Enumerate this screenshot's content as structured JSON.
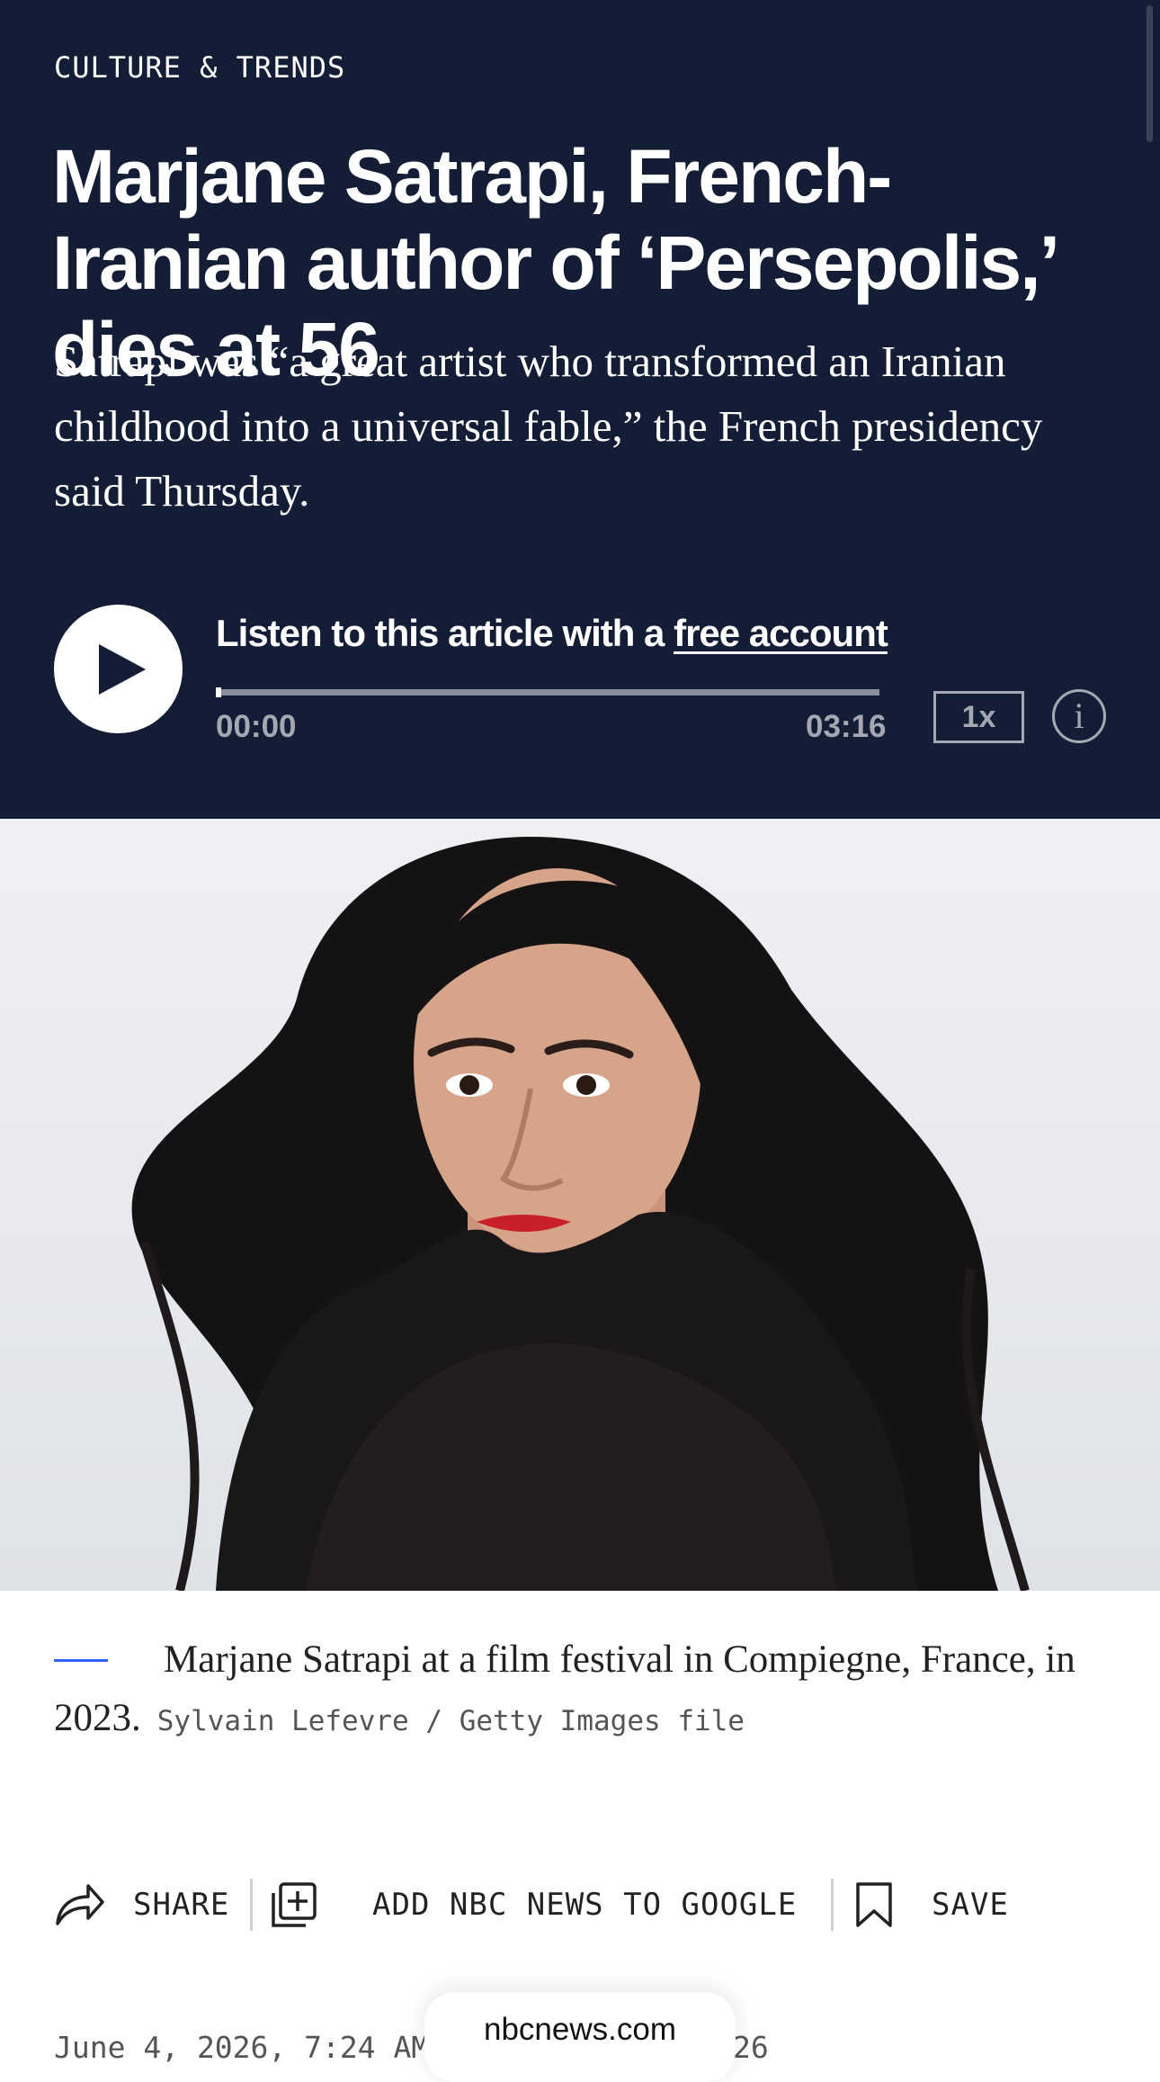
{
  "article": {
    "section": "CULTURE & TRENDS",
    "headline": "Marjane Satrapi, French-Iranian author of ‘Persepolis,’ dies at 56",
    "dek": "Satrapi was “a great artist who transformed an Iranian childhood into a universal fable,” the French presidency said Thursday."
  },
  "player": {
    "listen_prefix": "Listen to this article with a ",
    "listen_link": "free account",
    "time_current": "00:00",
    "time_total": "03:16",
    "progress": 0,
    "speed": "1x",
    "info": "i",
    "play_icon": "play-icon"
  },
  "photo": {
    "caption": "Marjane Satrapi at a film festival in Compiegne, France, in 2023.",
    "credit": "Sylvain Lefevre / Getty Images file"
  },
  "actions": {
    "share": "SHARE",
    "add_google": "ADD NBC NEWS TO GOOGLE",
    "save": "SAVE"
  },
  "dateline": "June 4, 2026, 7:24 AM                      June 4, 2026, 7:26",
  "browser": {
    "url": "nbcnews.com"
  },
  "colors": {
    "hero_bg": "#131d36",
    "caption_rule": "#3061ff",
    "muted": "#a3a8b3"
  }
}
